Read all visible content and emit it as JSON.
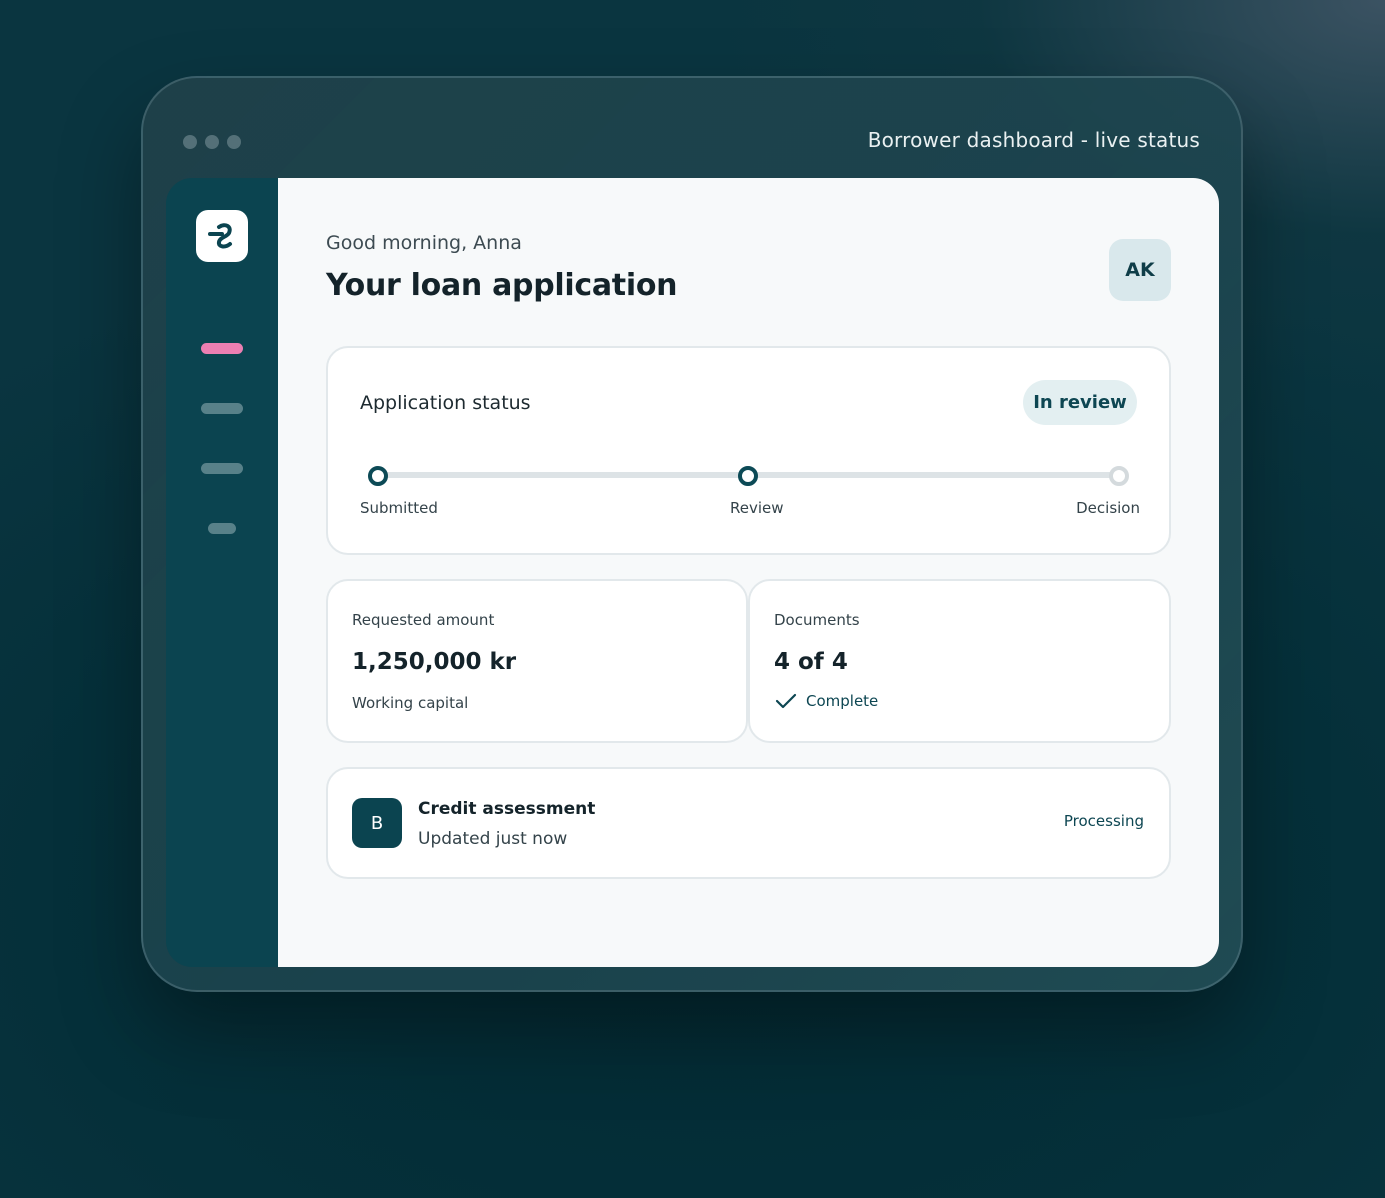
{
  "window": {
    "title": "Borrower dashboard - live status"
  },
  "sidebar": {
    "logo_icon": "brand-logo-icon",
    "nav_items": [
      {
        "icon": "nav-pill",
        "active": true,
        "color": "#ec7fb2"
      },
      {
        "icon": "nav-pill",
        "active": false
      },
      {
        "icon": "nav-pill",
        "active": false
      },
      {
        "icon": "nav-pill",
        "active": false
      }
    ]
  },
  "header": {
    "greeting": "Good morning, Anna",
    "title": "Your loan application",
    "avatar_initials": "AK"
  },
  "status": {
    "title": "Application status",
    "badge": "In review",
    "steps": [
      {
        "label": "Submitted",
        "state": "done"
      },
      {
        "label": "Review",
        "state": "current"
      },
      {
        "label": "Decision",
        "state": "pending"
      }
    ]
  },
  "amount": {
    "label": "Requested amount",
    "value": "1,250,000 kr",
    "sub": "Working capital"
  },
  "documents": {
    "label": "Documents",
    "value": "4 of 4",
    "status": "Complete",
    "status_icon": "check-icon"
  },
  "credit": {
    "icon_letter": "B",
    "title": "Credit assessment",
    "sub": "Updated just now",
    "status": "Processing"
  },
  "colors": {
    "accent": "#0b4450",
    "active_nav": "#ec7fb2",
    "badge_bg": "#e3eff1"
  }
}
